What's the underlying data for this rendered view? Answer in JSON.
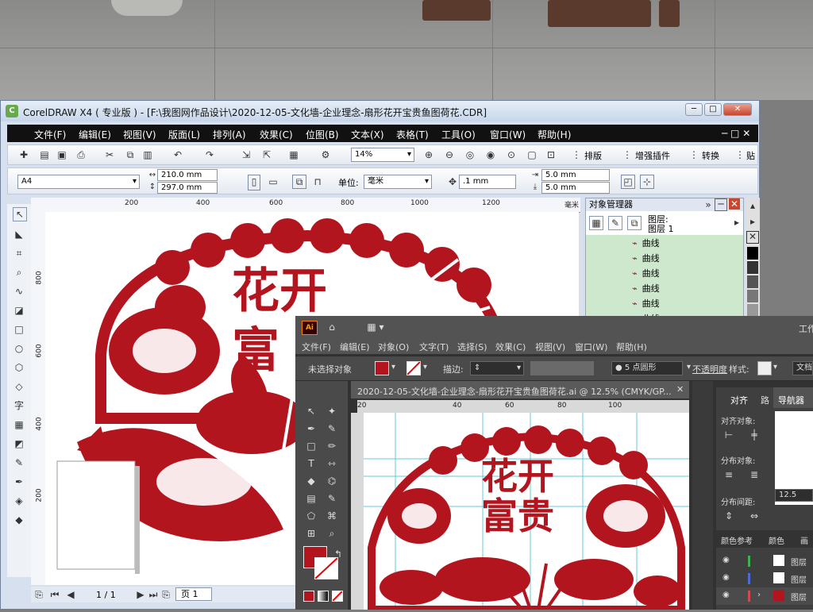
{
  "corel": {
    "title": "CorelDRAW X4 ( 专业版 ) - [F:\\我图网作品设计\\2020-12-05-文化墙-企业理念-扇形花开宝贵鱼图荷花.CDR]",
    "menu": [
      "文件(F)",
      "编辑(E)",
      "视图(V)",
      "版面(L)",
      "排列(A)",
      "效果(C)",
      "位图(B)",
      "文本(X)",
      "表格(T)",
      "工具(O)",
      "窗口(W)",
      "帮助(H)"
    ],
    "zoom": "14%",
    "toolbar_labels": {
      "layout": "排版",
      "plugin": "增强插件",
      "convert": "转换",
      "paste": "贴"
    },
    "page_size": "A4",
    "width": "210.0 mm",
    "height": "297.0 mm",
    "unit_label": "单位:",
    "unit": "毫米",
    "nudge": ".1 mm",
    "dup_x": "5.0 mm",
    "dup_y": "5.0 mm",
    "ruler_h": [
      "200",
      "400",
      "600",
      "800",
      "1000",
      "1200",
      "毫米"
    ],
    "ruler_v": [
      "800",
      "600",
      "400",
      "200"
    ],
    "docker": {
      "title": "对象管理器",
      "layer_line1": "图层:",
      "layer_line2": "图层 1",
      "objects": [
        "曲线",
        "曲线",
        "曲线",
        "曲线",
        "曲线",
        "曲线"
      ]
    },
    "page_nav": "1 / 1",
    "page_tab": "页 1",
    "artwork": {
      "line1": "花开",
      "line2": "富"
    }
  },
  "illustrator": {
    "app_badge": "Ai",
    "right_label": "工作",
    "menu": [
      "文件(F)",
      "编辑(E)",
      "对象(O)",
      "文字(T)",
      "选择(S)",
      "效果(C)",
      "视图(V)",
      "窗口(W)",
      "帮助(H)"
    ],
    "no_selection": "未选择对象",
    "stroke_label": "描边:",
    "brush": "5 点圆形",
    "opacity_label": "不透明度",
    "style_label": "样式:",
    "doc_label": "文档",
    "doc_tab": "2020-12-05-文化墙-企业理念-扇形花开宝贵鱼图荷花.ai @ 12.5% (CMYK/GP...",
    "ruler": [
      "20",
      "40",
      "60",
      "80",
      "100"
    ],
    "panel_tabs": [
      "对齐",
      "路"
    ],
    "navigator": "导航器",
    "align_labels": [
      "对齐对象:",
      "分布对象:",
      "分布间距:"
    ],
    "zoom_value": "12.5",
    "bottom_tabs": [
      "颜色参考",
      "颜色",
      "画"
    ],
    "layers": [
      "图层",
      "图层",
      "图层"
    ],
    "artwork": {
      "line1": "花开",
      "line2": "富贵"
    }
  },
  "colors": {
    "artwork_red": "#b3151f",
    "ai_dark": "#323232",
    "corel_menu": "#111111"
  }
}
